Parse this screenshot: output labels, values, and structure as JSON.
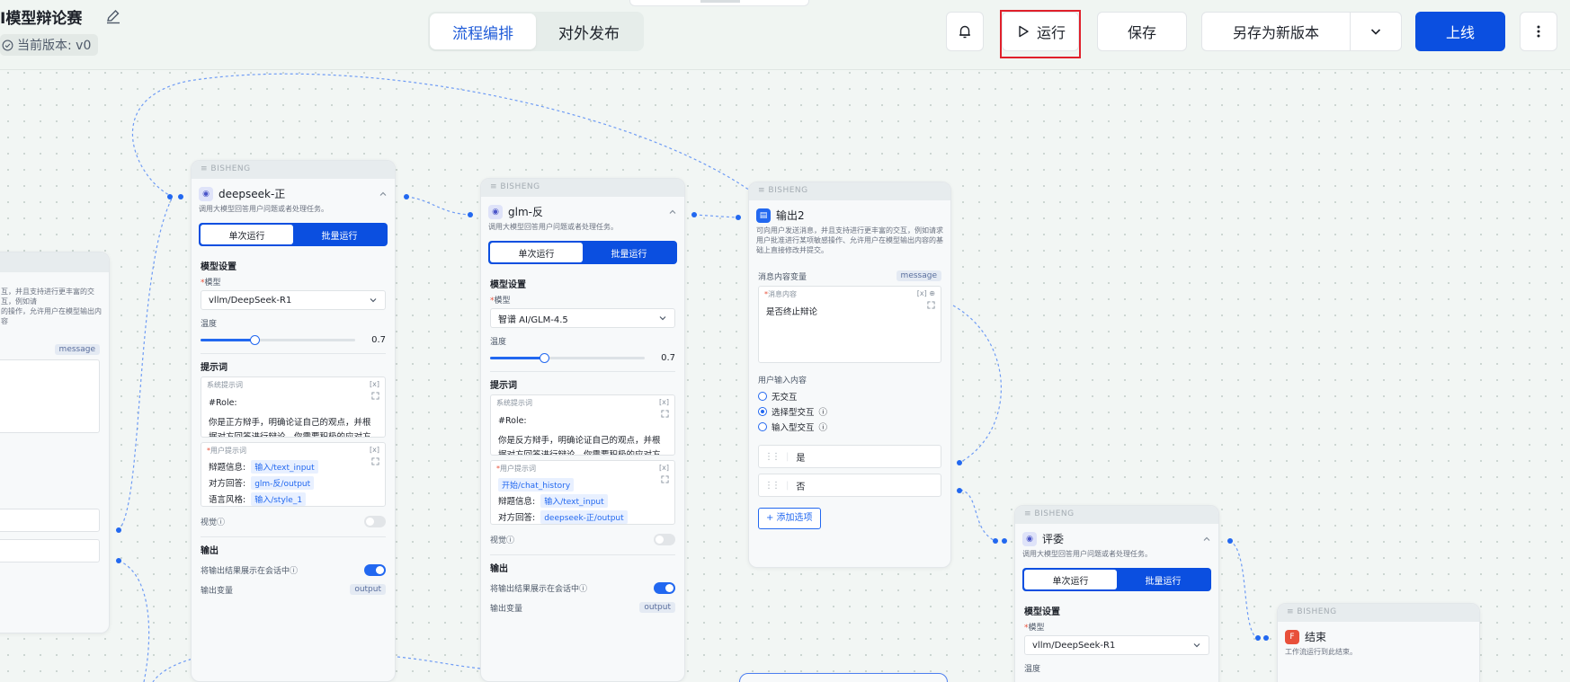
{
  "header": {
    "title": "I模型辩论赛",
    "version": "当前版本: v0",
    "tabs": {
      "orchestrate": "流程编排",
      "publish": "对外发布"
    },
    "buttons": {
      "run": "运行",
      "save": "保存",
      "save_as": "另存为新版本",
      "online": "上线"
    }
  },
  "brand": "BISHENG",
  "left_partial": {
    "desc": "互，并且支持进行更丰富的交互，例如请\n的操作，允许用户在模型输出内容",
    "tag": "message"
  },
  "node_zheng": {
    "title": "deepseek-正",
    "desc": "调用大模型回答用户问题或者处理任务。",
    "tab_single": "单次运行",
    "tab_batch": "批量运行",
    "model_section": "模型设置",
    "model_label": "模型",
    "model_value": "vllm/DeepSeek-R1",
    "temp_label": "温度",
    "temp_value": "0.7",
    "prompt_section": "提示词",
    "system_prompt_label": "系统提示词",
    "system_prompt_line1": "#Role:",
    "system_prompt_line2": "你是正方辩手，明确论证自己的观点，并根",
    "system_prompt_line3": "据对方回答进行辩论，你需要积极的应对方",
    "user_prompt_label": "用户提示词",
    "vars": [
      {
        "label": "辩题信息:",
        "chip": "输入/text_input"
      },
      {
        "label": "对方回答:",
        "chip": "glm-反/output"
      },
      {
        "label": "语言风格:",
        "chip": "输入/style_1"
      }
    ],
    "vision_label": "视觉",
    "output_section": "输出",
    "show_output_label": "将输出结果展示在会话中",
    "output_var_label": "输出变量",
    "output_var_tag": "output"
  },
  "node_fan": {
    "title": "glm-反",
    "desc": "调用大模型回答用户问题或者处理任务。",
    "tab_single": "单次运行",
    "tab_batch": "批量运行",
    "model_section": "模型设置",
    "model_label": "模型",
    "model_value": "智谱 AI/GLM-4.5",
    "temp_label": "温度",
    "temp_value": "0.7",
    "prompt_section": "提示词",
    "system_prompt_label": "系统提示词",
    "system_prompt_line1": "#Role:",
    "system_prompt_line2": "你是反方辩手，明确论证自己的观点，并根",
    "system_prompt_line3": "据对方回答进行辩论，你需要积极的应对方",
    "user_prompt_label": "用户提示词",
    "vars": [
      {
        "label": "",
        "chip": "开始/chat_history"
      },
      {
        "label": "辩题信息:",
        "chip": "输入/text_input"
      },
      {
        "label": "对方回答:",
        "chip": "deepseek-正/output"
      }
    ],
    "vision_label": "视觉",
    "output_section": "输出",
    "show_output_label": "将输出结果展示在会话中",
    "output_var_label": "输出变量",
    "output_var_tag": "output"
  },
  "node_output2": {
    "title": "输出2",
    "desc": "可向用户发送消息，并且支持进行更丰富的交互，例如请求用户批准进行某项敏感操作、允许用户在模型输出内容的基础上直接修改并提交。",
    "msg_var_label": "消息内容变量",
    "msg_var_tag": "message",
    "msg_content_label": "消息内容",
    "msg_content": "是否终止辩论",
    "user_input_label": "用户输入内容",
    "radios": [
      "无交互",
      "选择型交互",
      "输入型交互"
    ],
    "options": [
      "是",
      "否"
    ],
    "add_option": "+ 添加选项"
  },
  "node_judge": {
    "title": "评委",
    "desc": "调用大模型回答用户问题或者处理任务。",
    "tab_single": "单次运行",
    "tab_batch": "批量运行",
    "model_section": "模型设置",
    "model_label": "模型",
    "model_value": "vllm/DeepSeek-R1",
    "temp_label": "温度"
  },
  "node_end": {
    "title": "结束",
    "desc": "工作流运行到此结束。"
  }
}
